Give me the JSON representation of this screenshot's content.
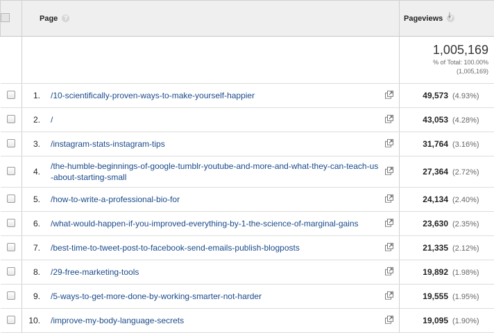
{
  "header": {
    "page_label": "Page",
    "pageviews_label": "Pageviews",
    "help_glyph": "?",
    "sort_glyph": "↓"
  },
  "total": {
    "value": "1,005,169",
    "line1": "% of Total: 100.00%",
    "line2": "(1,005,169)"
  },
  "rows": [
    {
      "rank": "1.",
      "page": "/10-scientifically-proven-ways-to-make-yourself-happier",
      "pageviews": "49,573",
      "pct": "(4.93%)"
    },
    {
      "rank": "2.",
      "page": "/",
      "pageviews": "43,053",
      "pct": "(4.28%)"
    },
    {
      "rank": "3.",
      "page": "/instagram-stats-instagram-tips",
      "pageviews": "31,764",
      "pct": "(3.16%)"
    },
    {
      "rank": "4.",
      "page": "/the-humble-beginnings-of-google-tumblr-youtube-and-more-and-what-they-can-teach-us-about-starting-small",
      "pageviews": "27,364",
      "pct": "(2.72%)"
    },
    {
      "rank": "5.",
      "page": "/how-to-write-a-professional-bio-for",
      "pageviews": "24,134",
      "pct": "(2.40%)"
    },
    {
      "rank": "6.",
      "page": "/what-would-happen-if-you-improved-everything-by-1-the-science-of-marginal-gains",
      "pageviews": "23,630",
      "pct": "(2.35%)"
    },
    {
      "rank": "7.",
      "page": "/best-time-to-tweet-post-to-facebook-send-emails-publish-blogposts",
      "pageviews": "21,335",
      "pct": "(2.12%)"
    },
    {
      "rank": "8.",
      "page": "/29-free-marketing-tools",
      "pageviews": "19,892",
      "pct": "(1.98%)"
    },
    {
      "rank": "9.",
      "page": "/5-ways-to-get-more-done-by-working-smarter-not-harder",
      "pageviews": "19,555",
      "pct": "(1.95%)"
    },
    {
      "rank": "10.",
      "page": "/improve-my-body-language-secrets",
      "pageviews": "19,095",
      "pct": "(1.90%)"
    }
  ]
}
